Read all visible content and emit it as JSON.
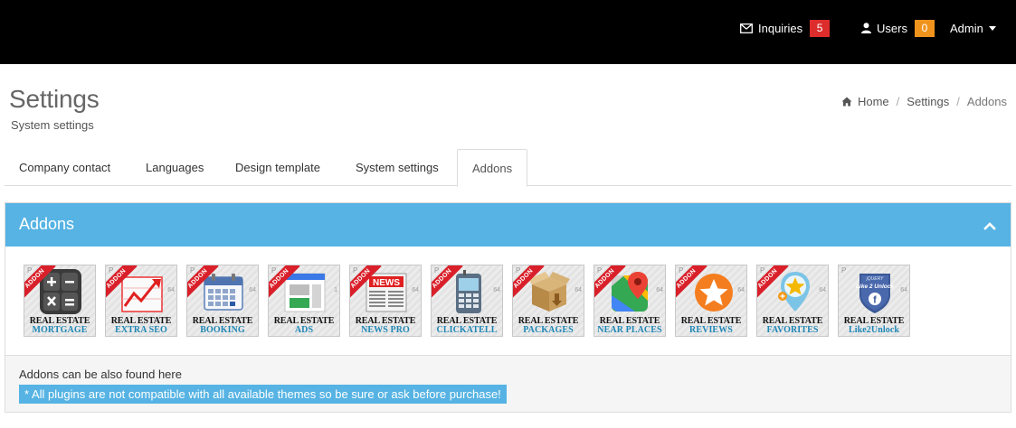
{
  "topbar": {
    "inquiries": {
      "label": "Inquiries",
      "count": "5",
      "icon": "envelope-icon",
      "color": "#dd2c2c"
    },
    "users": {
      "label": "Users",
      "count": "0",
      "icon": "user-icon",
      "color": "#f0931c"
    },
    "admin": {
      "label": "Admin"
    }
  },
  "header": {
    "title": "Settings",
    "subtitle": "System settings",
    "breadcrumb": [
      "Home",
      "Settings",
      "Addons"
    ]
  },
  "tabs": [
    "Company contact",
    "Languages",
    "Design template",
    "System settings",
    "Addons"
  ],
  "active_tab": "Addons",
  "panel": {
    "title": "Addons",
    "accent_color": "#56b3e3",
    "addons": [
      {
        "line1": "REAL ESTATE",
        "line2": "MORTGAGE",
        "ribbon": "ADDON",
        "icon": "calculator-icon"
      },
      {
        "line1": "REAL ESTATE",
        "line2": "EXTRA SEO",
        "ribbon": "ADDON",
        "icon": "trend-chart-icon"
      },
      {
        "line1": "REAL ESTATE",
        "line2": "BOOKING",
        "ribbon": "ADDON",
        "icon": "calendar-icon"
      },
      {
        "line1": "REAL ESTATE",
        "line2": "ADS",
        "ribbon": "ADDON",
        "icon": "ad-layout-icon"
      },
      {
        "line1": "REAL ESTATE",
        "line2": "NEWS PRO",
        "ribbon": "ADDON",
        "icon": "newspaper-icon",
        "art_text": "NEWS"
      },
      {
        "line1": "REAL ESTATE",
        "line2": "CLICKATELL",
        "ribbon": "ADDON",
        "icon": "phone-icon"
      },
      {
        "line1": "REAL ESTATE",
        "line2": "PACKAGES",
        "ribbon": "ADDON",
        "icon": "package-icon"
      },
      {
        "line1": "REAL ESTATE",
        "line2": "NEAR PLACES",
        "ribbon": "ADDON",
        "icon": "map-pin-icon"
      },
      {
        "line1": "REAL ESTATE",
        "line2": "REVIEWS",
        "ribbon": "ADDON",
        "icon": "star-icon"
      },
      {
        "line1": "REAL ESTATE",
        "line2": "FAVORITES",
        "ribbon": "ADDON",
        "icon": "favorite-star-icon"
      },
      {
        "line1": "REAL ESTATE",
        "line2": "Like2Unlock",
        "ribbon": "",
        "icon": "like-unlock-badge-icon",
        "art_text_top": "jQUERY",
        "art_text": "Like 2 Unlock"
      }
    ],
    "footer_text": "Addons can be also found here",
    "footer_note": "* All plugins are not compatible with all available themes so be sure or ask before purchase!"
  }
}
